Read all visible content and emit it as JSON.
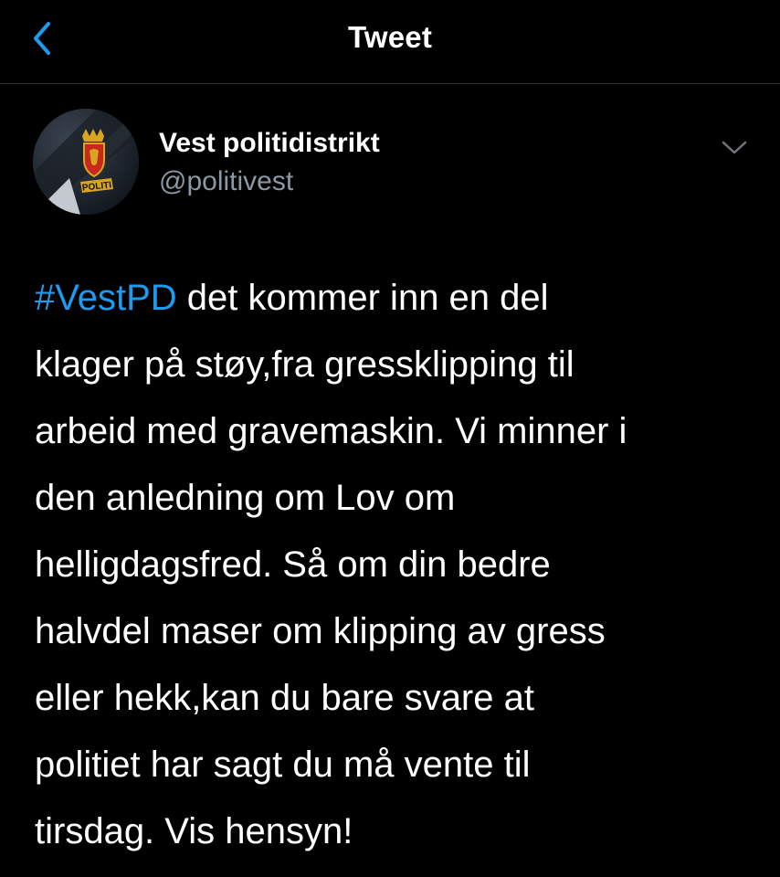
{
  "header": {
    "title": "Tweet",
    "back_icon": "chevron-left-icon",
    "accent_color": "#1d9bf0"
  },
  "author": {
    "display_name": "Vest politidistrikt",
    "handle": "@politivest",
    "avatar": {
      "description_icon": "police-badge-avatar",
      "badge_text": "POLITI"
    },
    "more_icon": "chevron-down-icon"
  },
  "tweet": {
    "hashtag": "#VestPD",
    "lines": [
      " det kommer inn en del",
      "klager på støy,fra gressklipping til",
      "arbeid med gravemaskin. Vi minner i",
      "den anledning om Lov om",
      "helligdagsfred. Så om din bedre",
      "halvdel maser om klipping av gress",
      "eller hekk,kan du bare svare at",
      "politiet har sagt du må vente til",
      "tirsdag. Vis hensyn!"
    ]
  },
  "colors": {
    "background": "#000000",
    "text": "#ffffff",
    "secondary_text": "#8b98a5",
    "link": "#1d9bf0"
  }
}
